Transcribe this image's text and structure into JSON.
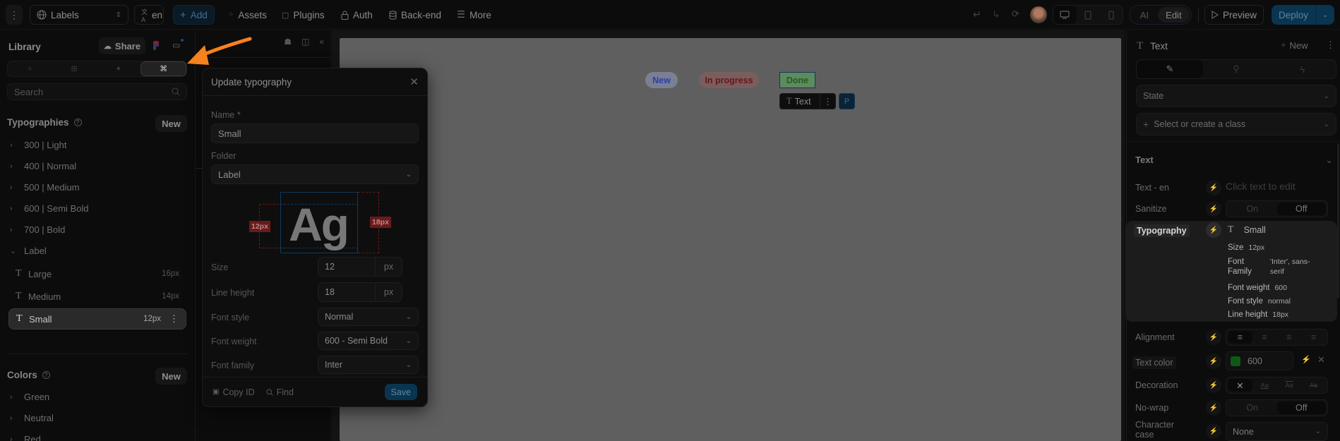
{
  "topbar": {
    "page_select": "Labels",
    "language": "en",
    "add_label": "Add",
    "nav": [
      {
        "icon": "assets-icon",
        "label": "Assets"
      },
      {
        "icon": "plugins-icon",
        "label": "Plugins"
      },
      {
        "icon": "lock-icon",
        "label": "Auth"
      },
      {
        "icon": "database-icon",
        "label": "Back-end"
      },
      {
        "icon": "menu-icon",
        "label": "More"
      }
    ],
    "mode_ai": "AI",
    "mode_edit": "Edit",
    "preview_label": "Preview",
    "deploy_label": "Deploy"
  },
  "library": {
    "title": "Library",
    "share_label": "Share",
    "search_placeholder": "Search",
    "typographies_title": "Typographies",
    "new_label": "New",
    "folders": [
      "300 | Light",
      "400 | Normal",
      "500 | Medium",
      "600 | Semi Bold",
      "700 | Bold"
    ],
    "open_folder": "Label",
    "items": [
      {
        "name": "Large",
        "size": "16px"
      },
      {
        "name": "Medium",
        "size": "14px"
      },
      {
        "name": "Small",
        "size": "12px"
      }
    ],
    "colors_title": "Colors",
    "color_folders": [
      "Green",
      "Neutral",
      "Red"
    ]
  },
  "modal": {
    "title": "Update typography",
    "name_label": "Name *",
    "name_value": "Small",
    "folder_label": "Folder",
    "folder_value": "Label",
    "preview_text": "Ag",
    "size_marker": "12px",
    "lineheight_marker": "18px",
    "size_label": "Size",
    "size_value": "12",
    "size_unit": "px",
    "line_height_label": "Line height",
    "line_height_value": "18",
    "line_height_unit": "px",
    "font_style_label": "Font style",
    "font_style_value": "Normal",
    "font_weight_label": "Font weight",
    "font_weight_value": "600 - Semi Bold",
    "font_family_label": "Font family",
    "font_family_value": "Inter",
    "copy_id_label": "Copy ID",
    "find_label": "Find",
    "save_label": "Save"
  },
  "canvas": {
    "badges": [
      {
        "label": "New",
        "color": "#2a3fa8",
        "bg": "#7a7f94"
      },
      {
        "label": "In progress",
        "color": "#6b1414",
        "bg": "#7a5e5e"
      },
      {
        "label": "Done",
        "color": "#1f5e1f",
        "bg": "#5f8a5f"
      }
    ],
    "selection_label": "Text",
    "parent_label": "P"
  },
  "properties": {
    "element_type": "Text",
    "new_label": "New",
    "state_placeholder": "State",
    "class_placeholder": "Select or create a class",
    "section_title": "Text",
    "text_en_label": "Text - en",
    "text_en_placeholder": "Click text to edit",
    "sanitize_label": "Sanitize",
    "on_label": "On",
    "off_label": "Off",
    "typography_label": "Typography",
    "typography_value": "Small",
    "typo_details": [
      {
        "k": "Size",
        "v": "12px"
      },
      {
        "k": "Font Family",
        "v": "'Inter', sans-serif"
      },
      {
        "k": "Font weight",
        "v": "600"
      },
      {
        "k": "Font style",
        "v": "normal"
      },
      {
        "k": "Line height",
        "v": "18px"
      }
    ],
    "alignment_label": "Alignment",
    "text_color_label": "Text color",
    "text_color_value": "600",
    "text_color_swatch": "#0e5a14",
    "decoration_label": "Decoration",
    "nowrap_label": "No-wrap",
    "character_case_label": "Character case",
    "character_case_value": "None"
  },
  "annotation": {
    "arrow_color": "#f5821f"
  }
}
